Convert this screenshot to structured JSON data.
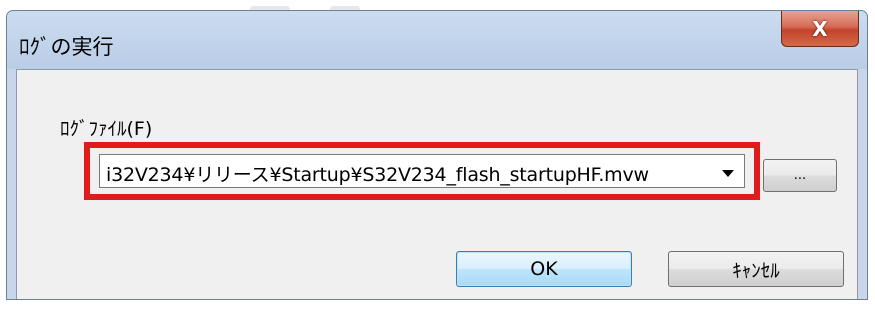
{
  "dialog": {
    "title": "ﾛｸﾞの実行",
    "close_label": "X",
    "file_label": "ﾛｸﾞﾌｧｲﾙ(F)",
    "file_value": "i32V234¥リリース¥Startup¥S32V234_flash_startupHF.mvw",
    "browse_label": "...",
    "ok_label": "OK",
    "cancel_label": "ｷｬﾝｾﾙ"
  },
  "colors": {
    "highlight": "#e01b1b",
    "ok_border": "#3c7fb1",
    "close_button": "#c2432b"
  }
}
